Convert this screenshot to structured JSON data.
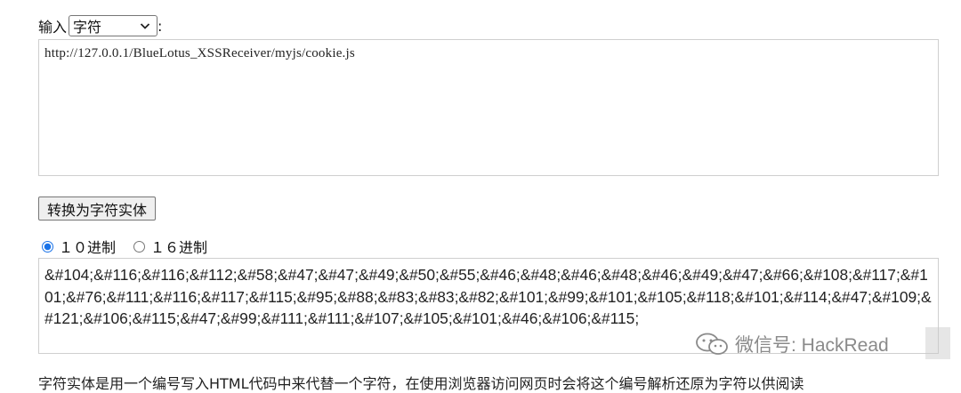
{
  "form": {
    "input_label": "输入",
    "mode_select": "字符",
    "colon": ":",
    "input_value": "http://127.0.0.1/BlueLotus_XSSReceiver/myjs/cookie.js",
    "convert_button": "转换为字符实体",
    "radix_options": [
      {
        "label": "１０进制",
        "checked": true
      },
      {
        "label": "１６进制",
        "checked": false
      }
    ],
    "output_value": "&#104;&#116;&#116;&#112;&#58;&#47;&#47;&#49;&#50;&#55;&#46;&#48;&#46;&#48;&#46;&#49;&#47;&#66;&#108;&#117;&#101;&#76;&#111;&#116;&#117;&#115;&#95;&#88;&#83;&#83;&#82;&#101;&#99;&#101;&#105;&#118;&#101;&#114;&#47;&#109;&#121;&#106;&#115;&#47;&#99;&#111;&#111;&#107;&#105;&#101;&#46;&#106;&#115;",
    "description": "字符实体是用一个编号写入HTML代码中来代替一个字符，在使用浏览器访问网页时会将这个编号解析还原为字符以供阅读"
  },
  "watermark": {
    "icon": "wechat-icon",
    "text": "微信号: HackRead"
  }
}
